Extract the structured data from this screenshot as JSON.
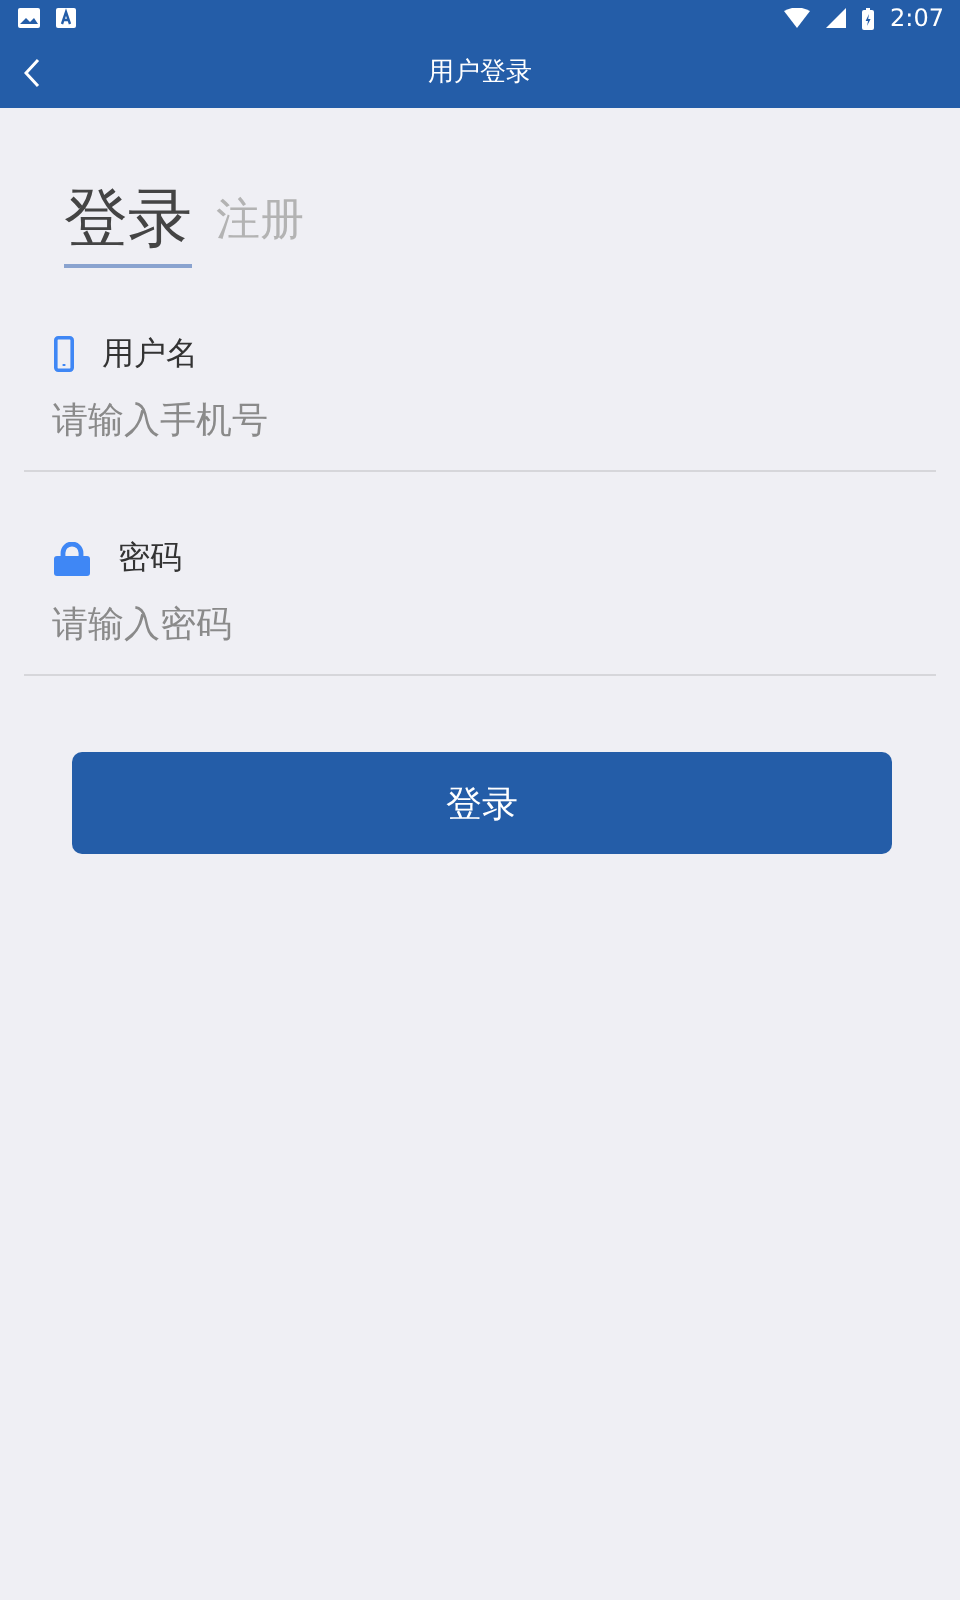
{
  "status_bar": {
    "time": "2:07"
  },
  "app_bar": {
    "title": "用户登录"
  },
  "tabs": [
    {
      "label": "登录",
      "selected": true
    },
    {
      "label": "注册",
      "selected": false
    }
  ],
  "fields": [
    {
      "kind": "phone",
      "label": "用户名",
      "placeholder": "请输入手机号"
    },
    {
      "kind": "password",
      "label": "密码",
      "placeholder": "请输入密码"
    }
  ],
  "submit": {
    "label": "登录"
  }
}
